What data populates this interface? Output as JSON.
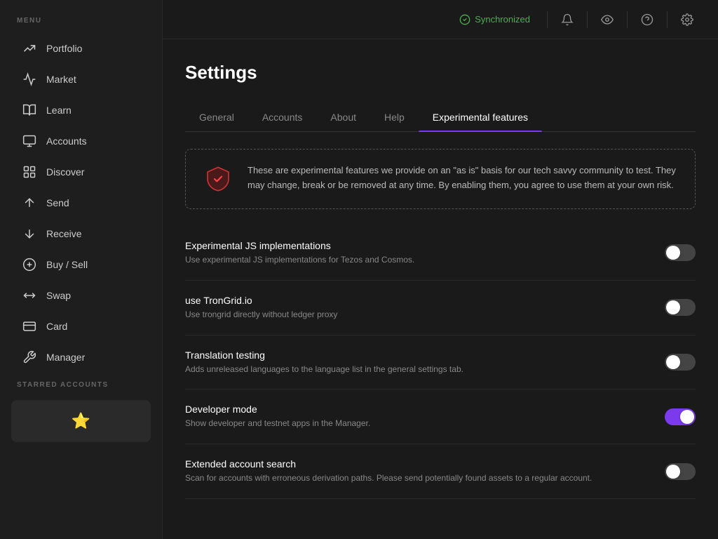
{
  "sidebar": {
    "menu_label": "MENU",
    "items": [
      {
        "id": "portfolio",
        "label": "Portfolio",
        "icon": "📈"
      },
      {
        "id": "market",
        "label": "Market",
        "icon": "📊"
      },
      {
        "id": "learn",
        "label": "Learn",
        "icon": "🎓"
      },
      {
        "id": "accounts",
        "label": "Accounts",
        "icon": "🗂"
      },
      {
        "id": "discover",
        "label": "Discover",
        "icon": "⊞"
      },
      {
        "id": "send",
        "label": "Send",
        "icon": "↑"
      },
      {
        "id": "receive",
        "label": "Receive",
        "icon": "↓"
      },
      {
        "id": "buy-sell",
        "label": "Buy / Sell",
        "icon": "💲"
      },
      {
        "id": "swap",
        "label": "Swap",
        "icon": "⇄"
      },
      {
        "id": "card",
        "label": "Card",
        "icon": "💳"
      },
      {
        "id": "manager",
        "label": "Manager",
        "icon": "🔧"
      }
    ],
    "starred_label": "STARRED ACCOUNTS"
  },
  "topbar": {
    "sync_label": "Synchronized",
    "icons": [
      "bell",
      "eye",
      "question",
      "gear"
    ]
  },
  "settings": {
    "page_title": "Settings",
    "tabs": [
      {
        "id": "general",
        "label": "General"
      },
      {
        "id": "accounts",
        "label": "Accounts"
      },
      {
        "id": "about",
        "label": "About"
      },
      {
        "id": "help",
        "label": "Help"
      },
      {
        "id": "experimental",
        "label": "Experimental features"
      }
    ],
    "active_tab": "experimental",
    "notice": {
      "text": "These are experimental features we provide on an \"as is\" basis for our tech savvy community to test. They may change, break or be removed at any time. By enabling them, you agree to use them at your own risk."
    },
    "features": [
      {
        "id": "experimental-js",
        "title": "Experimental JS implementations",
        "description": "Use experimental JS implementations for Tezos and Cosmos.",
        "enabled": false
      },
      {
        "id": "use-trongrid",
        "title": "use TronGrid.io",
        "description": "Use trongrid directly without ledger proxy",
        "enabled": false
      },
      {
        "id": "translation-testing",
        "title": "Translation testing",
        "description": "Adds unreleased languages to the language list in the general settings tab.",
        "enabled": false
      },
      {
        "id": "developer-mode",
        "title": "Developer mode",
        "description": "Show developer and testnet apps in the Manager.",
        "enabled": true
      },
      {
        "id": "extended-account-search",
        "title": "Extended account search",
        "description": "Scan for accounts with erroneous derivation paths. Please send potentially found assets to a regular account.",
        "enabled": false
      }
    ]
  }
}
